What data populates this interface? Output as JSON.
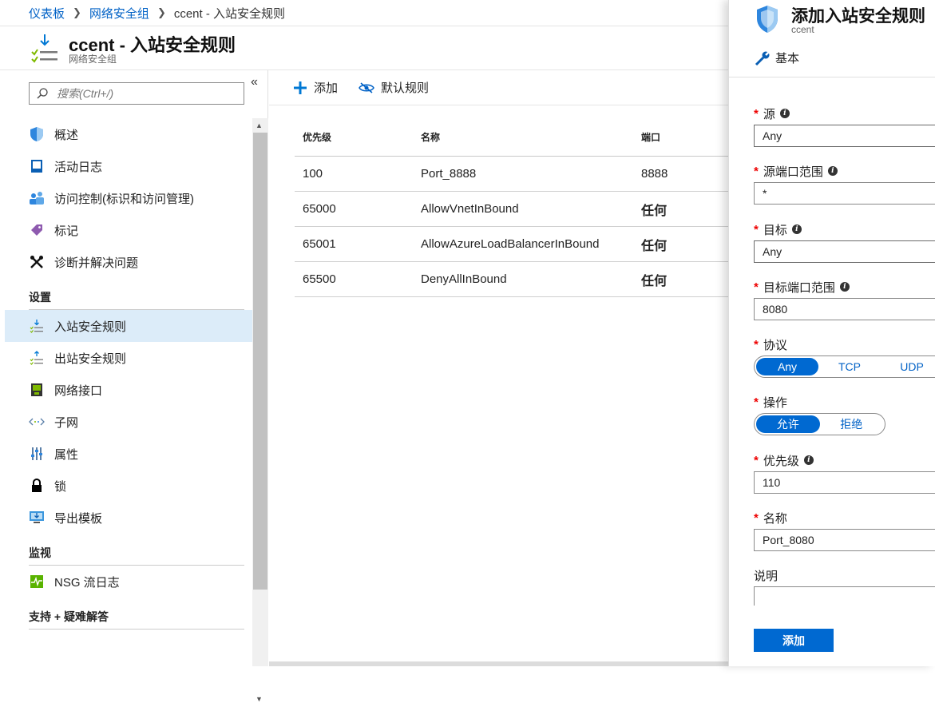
{
  "breadcrumb": {
    "items": [
      "仪表板",
      "网络安全组",
      "ccent - 入站安全规则"
    ]
  },
  "header": {
    "title": "ccent - 入站安全规则",
    "subtitle": "网络安全组"
  },
  "leftnav": {
    "search_placeholder": "搜索(Ctrl+/)",
    "collapse_label": "«",
    "items_top": [
      {
        "label": "概述",
        "icon": "shield-icon"
      },
      {
        "label": "活动日志",
        "icon": "activity-log-icon"
      },
      {
        "label": "访问控制(标识和访问管理)",
        "icon": "people-icon"
      },
      {
        "label": "标记",
        "icon": "tag-icon"
      },
      {
        "label": "诊断并解决问题",
        "icon": "tools-icon"
      }
    ],
    "section_settings": "设置",
    "items_settings": [
      {
        "label": "入站安全规则",
        "icon": "inbound-rules-icon",
        "active": true
      },
      {
        "label": "出站安全规则",
        "icon": "outbound-rules-icon"
      },
      {
        "label": "网络接口",
        "icon": "network-interface-icon"
      },
      {
        "label": "子网",
        "icon": "subnet-icon"
      },
      {
        "label": "属性",
        "icon": "properties-icon"
      },
      {
        "label": "锁",
        "icon": "lock-icon"
      },
      {
        "label": "导出模板",
        "icon": "export-template-icon"
      }
    ],
    "section_monitor": "监视",
    "items_monitor": [
      {
        "label": "NSG 流日志",
        "icon": "flow-log-icon"
      }
    ],
    "section_support": "支持 + 疑难解答"
  },
  "toolbar": {
    "add_label": "添加",
    "default_rules_label": "默认规则"
  },
  "table": {
    "headers": [
      "优先级",
      "名称",
      "端口"
    ],
    "rows": [
      {
        "priority": "100",
        "name": "Port_8888",
        "port": "8888"
      },
      {
        "priority": "65000",
        "name": "AllowVnetInBound",
        "port": "任何"
      },
      {
        "priority": "65001",
        "name": "AllowAzureLoadBalancerInBound",
        "port": "任何"
      },
      {
        "priority": "65500",
        "name": "DenyAllInBound",
        "port": "任何"
      }
    ]
  },
  "blade": {
    "title": "添加入站安全规则",
    "subtitle": "ccent",
    "tab_label": "基本",
    "source": {
      "label": "源",
      "value": "Any"
    },
    "source_port": {
      "label": "源端口范围",
      "value": "*"
    },
    "destination": {
      "label": "目标",
      "value": "Any"
    },
    "dest_port": {
      "label": "目标端口范围",
      "value": "8080"
    },
    "protocol": {
      "label": "协议",
      "options": [
        "Any",
        "TCP",
        "UDP"
      ],
      "selected": "Any"
    },
    "action": {
      "label": "操作",
      "options": [
        "允许",
        "拒绝"
      ],
      "selected": "允许"
    },
    "priority": {
      "label": "优先级",
      "value": "110"
    },
    "name": {
      "label": "名称",
      "value": "Port_8080"
    },
    "description": {
      "label": "说明",
      "value": ""
    },
    "add_button": "添加"
  },
  "colors": {
    "accent": "#0069d1",
    "link": "#0061c6",
    "active_nav": "#dcecf9",
    "required": "#e00000"
  }
}
